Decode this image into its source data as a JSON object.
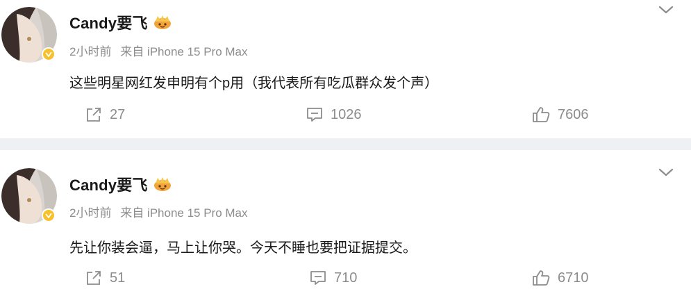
{
  "posts": [
    {
      "username": "Candy要飞",
      "time": "2小时前",
      "source": "来自 iPhone 15 Pro Max",
      "text": "这些明星网红发申明有个p用（我代表所有吃瓜群众发个声）",
      "repost_count": "27",
      "comment_count": "1026",
      "like_count": "7606"
    },
    {
      "username": "Candy要飞",
      "time": "2小时前",
      "source": "来自 iPhone 15 Pro Max",
      "text": "先让你装会逼，马上让你哭。今天不睡也要把证据提交。",
      "repost_count": "51",
      "comment_count": "710",
      "like_count": "6710"
    }
  ],
  "icons": {
    "more": "chevron-down-icon",
    "repost": "repost-icon",
    "comment": "comment-icon",
    "like": "thumbs-up-icon",
    "verified": "verified-badge-icon",
    "member_badge": "crown-badge-icon"
  },
  "colors": {
    "text": "#1a1a1a",
    "meta": "#8c8c8c",
    "separator": "#eef0f4",
    "verified": "#f6c12c"
  }
}
